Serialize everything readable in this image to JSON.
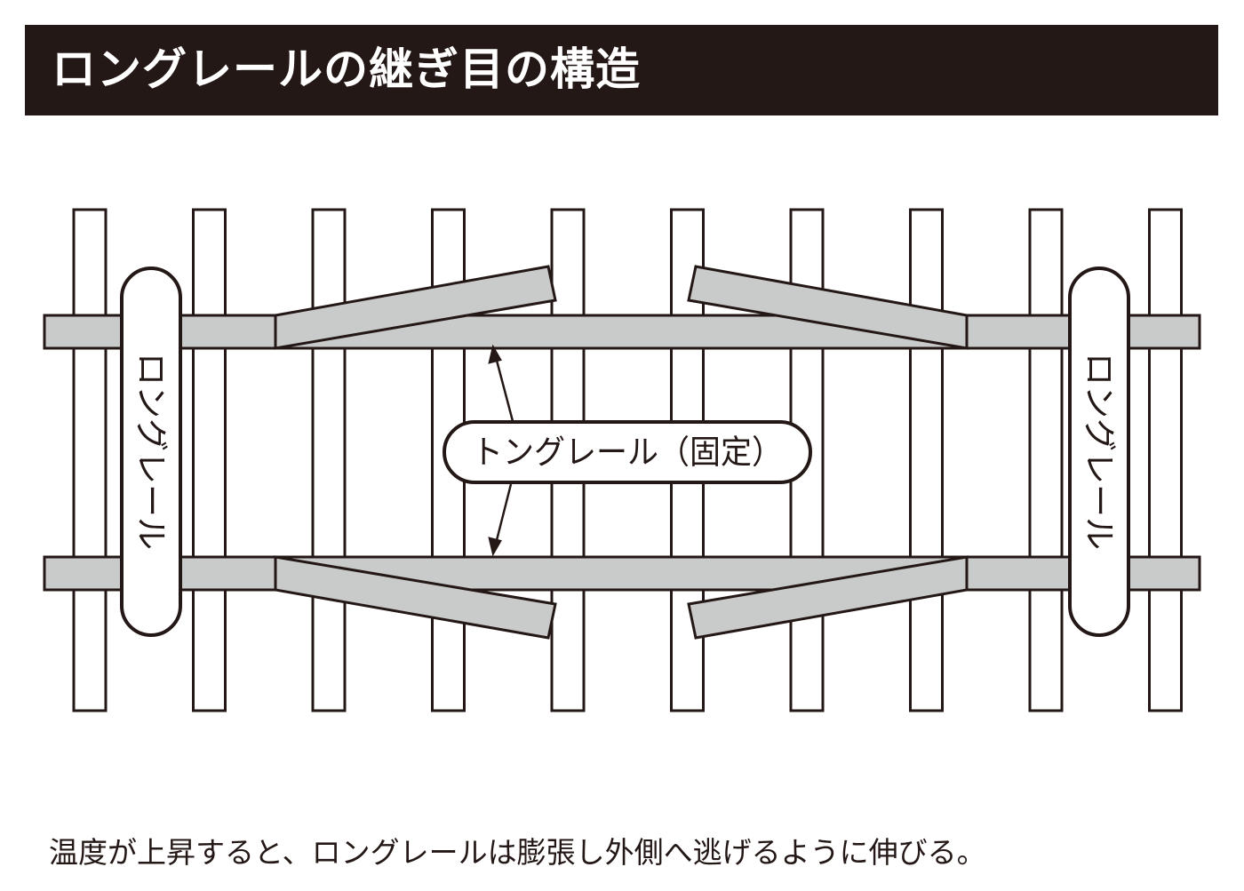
{
  "title": "ロングレールの継ぎ目の構造",
  "labels": {
    "long_rail_left": "ロングレール",
    "long_rail_right": "ロングレール",
    "tongue_rail": "トングレール（固定）"
  },
  "caption": "温度が上昇すると、ロングレールは膨張し外側へ逃げるように伸びる。",
  "colors": {
    "title_bar": "#231815",
    "rail": "#c9caca",
    "line": "#231815"
  }
}
